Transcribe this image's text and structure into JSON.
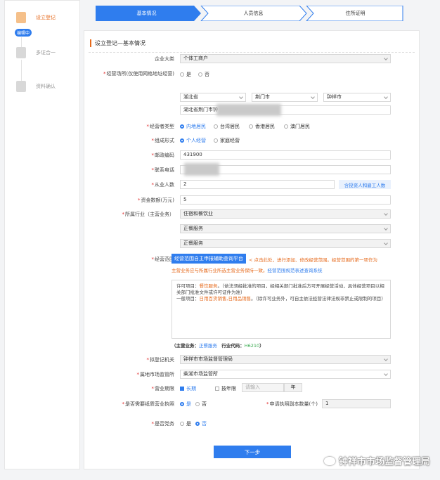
{
  "sidebar": {
    "steps": [
      {
        "label": "设立登记",
        "icon": "edit-icon",
        "color": "#e66a1c"
      },
      {
        "label": "多证合一",
        "icon": "doc-icon",
        "color": "#999999"
      },
      {
        "label": "资料确认",
        "icon": "file-icon",
        "color": "#999999"
      }
    ],
    "badge": "编辑中"
  },
  "stepbar": {
    "tabs": [
      "基本情况",
      "人员信息",
      "住所证明"
    ]
  },
  "form": {
    "section_title": "设立登记—基本情况",
    "company_type_label": "企业大类",
    "company_type_value": "个体工商户",
    "address_label": "经营场所(仅使用网格地址经营)",
    "address_opts": [
      "是",
      "否"
    ],
    "province": "湖北省",
    "city": "荆门市",
    "district": "钟祥市",
    "address_detail": "湖北省荆门市钟",
    "operator_type_label": "经营者类型",
    "operator_types": [
      "内地居民",
      "台湾居民",
      "香港居民",
      "澳门居民"
    ],
    "form_type_label": "组成形式",
    "form_types": [
      "个人经营",
      "家庭经营"
    ],
    "zip_label": "邮政编码",
    "zip_value": "431900",
    "phone_label": "联系电话",
    "staff_label": "从业人数",
    "staff_value": "2",
    "staff_button": "含投资人和雇工人数",
    "capital_label": "资金数额(万元)",
    "capital_value": "5",
    "industry_label": "所属行业（主营业务）",
    "industry_values": [
      "住宿和餐饮业",
      "正餐服务",
      "正餐服务"
    ],
    "scope_label": "经营范围",
    "scope_button": "经营范围自主申报辅助查询平台",
    "scope_tip_1": "点击此处，进行添加、修改经营范围。经营范围的第一项作为",
    "scope_tip_2": "主营业务应与所属行业所选主营业务保持一致。",
    "scope_tip_link": "经营范围规范表述查询系统",
    "scope_text_1": "许可项目：",
    "scope_text_1_hl": "餐饮服务",
    "scope_text_2": "。（依法须经批准的项目，经相关部门批准后方可开展经营活动，具体经营项目以相关部门批准文件或许可证件为准）",
    "scope_text_3": "一般项目：",
    "scope_text_3_hl": "日用百货销售,日用品销售",
    "scope_text_4": "。（除许可业务外，可自主依法经营法律法规非禁止或限制的项目）",
    "main_business_prefix": "（主营业务：",
    "main_business_value": "正餐服务",
    "industry_code_prefix": "行业代码：",
    "industry_code": "H6210",
    "main_business_suffix": "）",
    "reg_authority_label": "拟登记机关",
    "reg_authority_value": "钟祥市市场监督管理局",
    "supervision_label": "属地市场监管所",
    "supervision_value": "柴湖市场监管所",
    "term_label": "营业期限",
    "term_long": "长期",
    "term_years": "按年限",
    "term_placeholder": "请输入",
    "term_unit": "年",
    "paper_license_label": "是否需要纸质营业执照",
    "paper_opts": [
      "是",
      "否"
    ],
    "copy_count_label": "申请执照副本数量(个)",
    "copy_count_value": "1",
    "party_label": "是否党务",
    "party_opts": [
      "是",
      "否"
    ],
    "next_button": "下一步"
  },
  "watermark": "钟祥市市场监督管理局"
}
